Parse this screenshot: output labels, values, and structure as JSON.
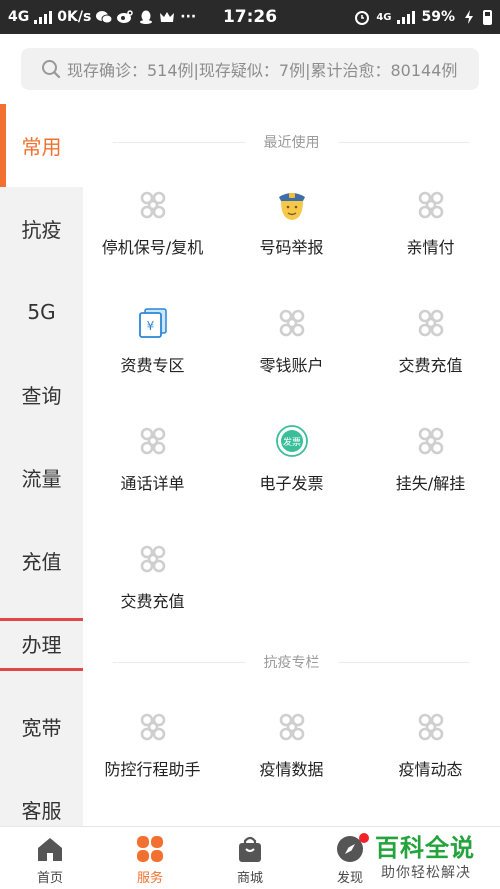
{
  "status_bar": {
    "network": "4G",
    "speed": "0K/s",
    "time": "17:26",
    "net_right": "4G",
    "battery": "59%",
    "more": "···"
  },
  "search": {
    "text": "现存确诊：514例|现存疑似：7例|累计治愈：80144例"
  },
  "sidebar": {
    "items": [
      "常用",
      "抗疫",
      "5G",
      "查询",
      "流量",
      "充值",
      "办理",
      "宽带",
      "客服"
    ],
    "active_index": 0
  },
  "sections": [
    {
      "title": "最近使用",
      "items": [
        {
          "label": "停机保号/复机",
          "icon": "unicom-logo-icon"
        },
        {
          "label": "号码举报",
          "icon": "police-officer-icon"
        },
        {
          "label": "亲情付",
          "icon": "unicom-logo-icon"
        },
        {
          "label": "资费专区",
          "icon": "tariff-yuan-icon"
        },
        {
          "label": "零钱账户",
          "icon": "unicom-logo-icon"
        },
        {
          "label": "交费充值",
          "icon": "unicom-logo-icon"
        },
        {
          "label": "通话详单",
          "icon": "unicom-logo-icon"
        },
        {
          "label": "电子发票",
          "icon": "invoice-badge-icon"
        },
        {
          "label": "挂失/解挂",
          "icon": "unicom-logo-icon"
        },
        {
          "label": "交费充值",
          "icon": "unicom-logo-icon"
        }
      ]
    },
    {
      "title": "抗疫专栏",
      "items": [
        {
          "label": "防控行程助手",
          "icon": "unicom-logo-icon"
        },
        {
          "label": "疫情数据",
          "icon": "unicom-logo-icon"
        },
        {
          "label": "疫情动态",
          "icon": "unicom-logo-icon"
        }
      ]
    }
  ],
  "invoice_badge_text": "发票",
  "tabs": [
    {
      "label": "首页",
      "icon": "home-icon"
    },
    {
      "label": "服务",
      "icon": "service-grid-icon"
    },
    {
      "label": "商城",
      "icon": "shopping-bag-icon"
    },
    {
      "label": "发现",
      "icon": "compass-icon"
    }
  ],
  "active_tab": 1,
  "watermark": {
    "title": "百科全说",
    "subtitle": "助你轻松解决"
  },
  "colors": {
    "accent": "#f27130",
    "unicom_gray": "#cfcfcf",
    "watermark_green": "#23a33c",
    "highlight_red": "#e04848"
  }
}
